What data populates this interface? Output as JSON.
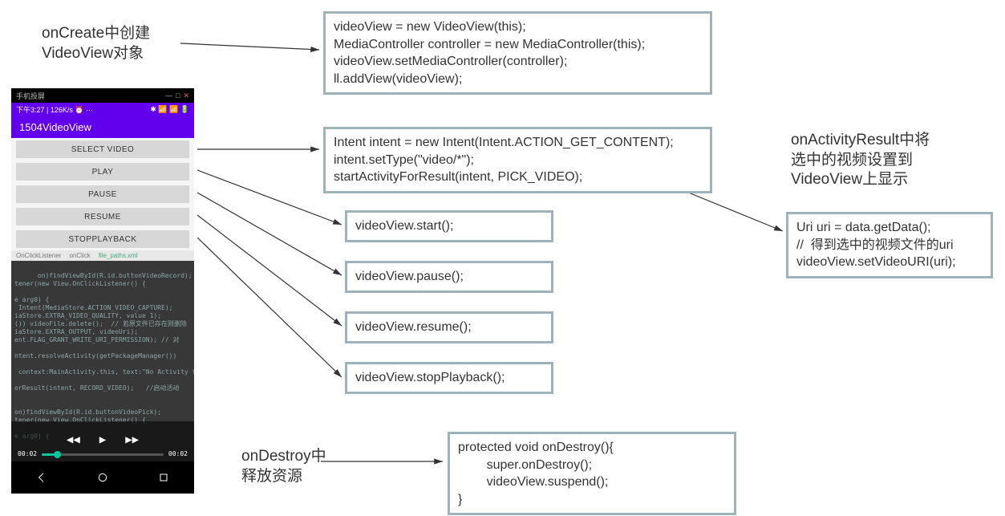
{
  "labels": {
    "oncreate": "onCreate中创建\nVideoView对象",
    "onactivityresult": "onActivityResult中将\n选中的视频设置到\nVideoView上显示",
    "ondestroy": "onDestroy中\n释放资源"
  },
  "code": {
    "oncreate": "videoView = new VideoView(this);\nMediaController controller = new MediaController(this);\nvideoView.setMediaController(controller);\nll.addView(videoView);",
    "intent": "Intent intent = new Intent(Intent.ACTION_GET_CONTENT);\nintent.setType(\"video/*\");\nstartActivityForResult(intent, PICK_VIDEO);",
    "start": "videoView.start();",
    "pause": "videoView.pause();",
    "resume": "videoView.resume();",
    "stopplayback": "videoView.stopPlayback();",
    "ondestroy": "protected void onDestroy(){\n        super.onDestroy();\n        videoView.suspend();\n}",
    "onactivityresult": "Uri uri = data.getData();\n//  得到选中的视频文件的uri\nvideoView.setVideoURI(uri);"
  },
  "phone": {
    "sysbar_label": "手机投屏",
    "status_left": "下午3:27 | 126K/s ⏰ ···",
    "status_right": "✱ 📶 📶 🔋",
    "app_title": "1504VideoView",
    "buttons": [
      "SELECT VIDEO",
      "PLAY",
      "PAUSE",
      "RESUME",
      "STOPPLAYBACK"
    ],
    "tabs": {
      "left": "OnClickListener",
      "mid": "onClick",
      "file": "file_paths.xml"
    },
    "video_frame_text": "on)findViewById(R.id.buttonVideoRecord);\ntener(new View.OnClickListener() {\n\ne arg0) {\n Intent(MediaStore.ACTION_VIDEO_CAPTURE);\niaStore.EXTRA_VIDEO_QUALITY, value 1);\n()) videoFile.delete();  // 若原文件已存在则删除\niaStore.EXTRA_OUTPUT, videoUri);\nent.FLAG_GRANT_WRITE_URI_PERMISSION); // 对\n\nntent.resolveActivity(getPackageManager())\n\n context:MainActivity.this, text:\"No Activity fo\n\norResult(intent, RECORD_VIDEO);   //启动活动\n\n\non)findViewById(R.id.buttonVideoPick);\ntener(new View.OnClickListener() {\n\ne arg0) {",
    "controls": {
      "time_left": "00:02",
      "time_right": "00:02"
    },
    "sys_icons": [
      "back-key",
      "home-key",
      "recent-key"
    ],
    "win_icons": [
      "minimize",
      "maximize",
      "close"
    ]
  }
}
